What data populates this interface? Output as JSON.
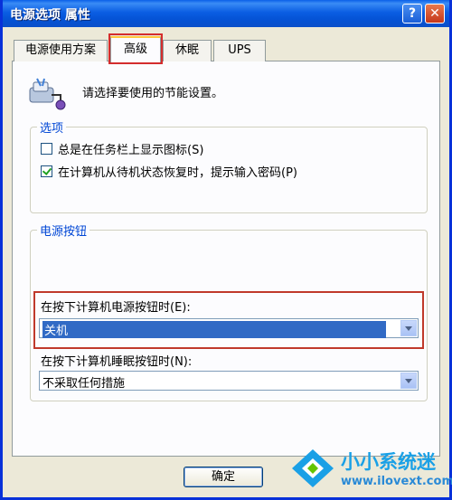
{
  "window": {
    "title": "电源选项 属性"
  },
  "titlebar": {
    "help_glyph": "?",
    "close_glyph": "✕"
  },
  "tabs": [
    {
      "label": "电源使用方案"
    },
    {
      "label": "高级",
      "active": true
    },
    {
      "label": "休眠"
    },
    {
      "label": "UPS"
    }
  ],
  "intro": {
    "icon": "power-options-icon",
    "text": "请选择要使用的节能设置。"
  },
  "options_group": {
    "title": "选项",
    "items": [
      {
        "label": "总是在任务栏上显示图标(S)",
        "checked": false
      },
      {
        "label": "在计算机从待机状态恢复时，提示输入密码(P)",
        "checked": true
      }
    ]
  },
  "power_buttons_group": {
    "title": "电源按钮",
    "power_button": {
      "label": "在按下计算机电源按钮时(E):",
      "value": "关机"
    },
    "sleep_button": {
      "label": "在按下计算机睡眠按钮时(N):",
      "value": "不采取任何措施"
    }
  },
  "footer": {
    "ok_label": "确定"
  },
  "watermark": {
    "brand": "小小系统迷",
    "site": "www.ilovext.com"
  },
  "colors": {
    "titlebar": "#0553d6",
    "group_title": "#0046d5",
    "highlight": "#316ac5",
    "annotation_red": "#d42d2d"
  }
}
